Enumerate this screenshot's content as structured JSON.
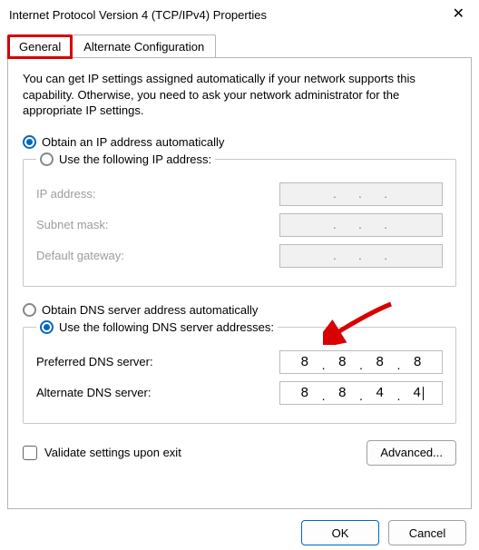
{
  "window": {
    "title": "Internet Protocol Version 4 (TCP/IPv4) Properties"
  },
  "tabs": {
    "general": "General",
    "alternate": "Alternate Configuration"
  },
  "intro": "You can get IP settings assigned automatically if your network supports this capability. Otherwise, you need to ask your network administrator for the appropriate IP settings.",
  "ip": {
    "auto_label": "Obtain an IP address automatically",
    "manual_label": "Use the following IP address:",
    "auto_selected": true,
    "fields": {
      "address": "IP address:",
      "subnet": "Subnet mask:",
      "gateway": "Default gateway:"
    }
  },
  "dns": {
    "auto_label": "Obtain DNS server address automatically",
    "manual_label": "Use the following DNS server addresses:",
    "manual_selected": true,
    "fields": {
      "preferred_label": "Preferred DNS server:",
      "preferred_value": [
        "8",
        "8",
        "8",
        "8"
      ],
      "alternate_label": "Alternate DNS server:",
      "alternate_value": [
        "8",
        "8",
        "4",
        "4"
      ]
    }
  },
  "validate_label": "Validate settings upon exit",
  "validate_checked": false,
  "buttons": {
    "advanced": "Advanced...",
    "ok": "OK",
    "cancel": "Cancel"
  }
}
